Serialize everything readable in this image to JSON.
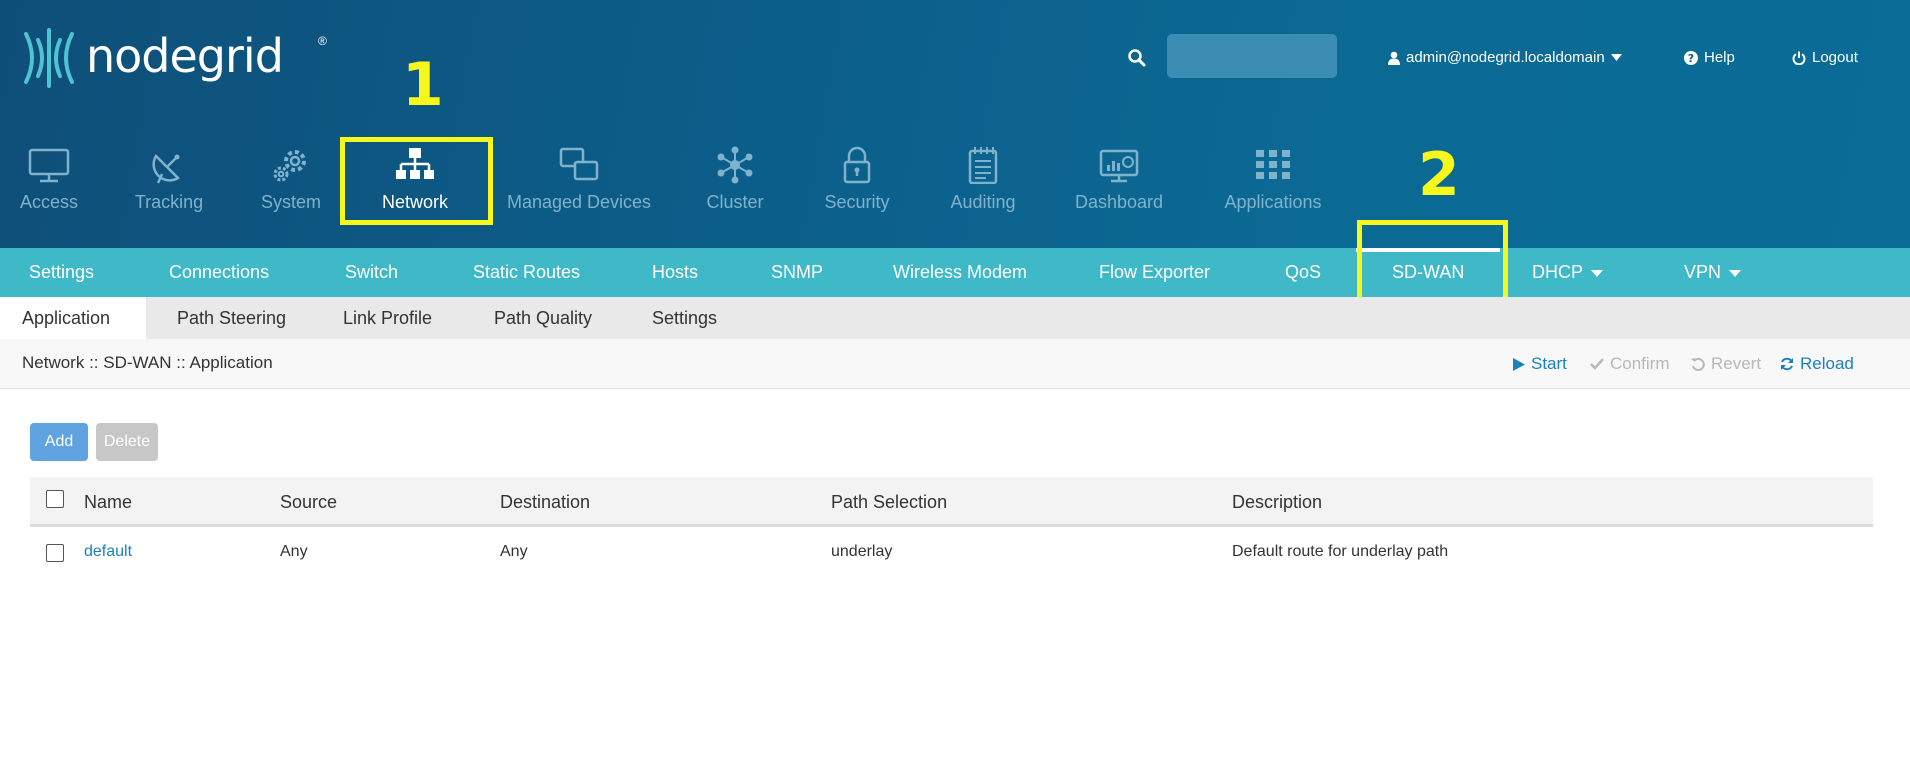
{
  "logo": {
    "text": "nodegrid",
    "reg": "®"
  },
  "search": {
    "placeholder": "",
    "value": ""
  },
  "user": {
    "label": "admin@nodegrid.localdomain"
  },
  "top_links": {
    "help": "Help",
    "logout": "Logout"
  },
  "main_nav": [
    {
      "label": "Access",
      "icon": "monitor-icon"
    },
    {
      "label": "Tracking",
      "icon": "satellite-dish-icon"
    },
    {
      "label": "System",
      "icon": "gears-icon"
    },
    {
      "label": "Network",
      "icon": "network-tree-icon",
      "active": true
    },
    {
      "label": "Managed Devices",
      "icon": "devices-icon"
    },
    {
      "label": "Cluster",
      "icon": "cluster-icon"
    },
    {
      "label": "Security",
      "icon": "lock-icon"
    },
    {
      "label": "Auditing",
      "icon": "notepad-icon"
    },
    {
      "label": "Dashboard",
      "icon": "dashboard-icon"
    },
    {
      "label": "Applications",
      "icon": "grid-icon"
    }
  ],
  "sub_nav": [
    {
      "label": "Settings"
    },
    {
      "label": "Connections"
    },
    {
      "label": "Switch"
    },
    {
      "label": "Static Routes"
    },
    {
      "label": "Hosts"
    },
    {
      "label": "SNMP"
    },
    {
      "label": "Wireless Modem"
    },
    {
      "label": "Flow Exporter"
    },
    {
      "label": "QoS"
    },
    {
      "label": "SD-WAN",
      "active": true
    },
    {
      "label": "DHCP",
      "dropdown": true
    },
    {
      "label": "VPN",
      "dropdown": true
    }
  ],
  "tabs": [
    {
      "label": "Application",
      "active": true
    },
    {
      "label": "Path Steering"
    },
    {
      "label": "Link Profile"
    },
    {
      "label": "Path Quality"
    },
    {
      "label": "Settings"
    }
  ],
  "breadcrumb": "Network :: SD-WAN :: Application",
  "actions": {
    "start": "Start",
    "confirm": "Confirm",
    "revert": "Revert",
    "reload": "Reload"
  },
  "buttons": {
    "add": "Add",
    "delete": "Delete"
  },
  "table": {
    "headers": [
      "Name",
      "Source",
      "Destination",
      "Path Selection",
      "Description"
    ],
    "rows": [
      {
        "name": "default",
        "source": "Any",
        "destination": "Any",
        "path_selection": "underlay",
        "description": "Default route for underlay path"
      }
    ]
  },
  "callouts": [
    "1",
    "2"
  ],
  "colors": {
    "header": "#0c5e8a",
    "subnav": "#3fb9c7",
    "highlight": "#f7f71c",
    "link": "#1a80bf"
  }
}
